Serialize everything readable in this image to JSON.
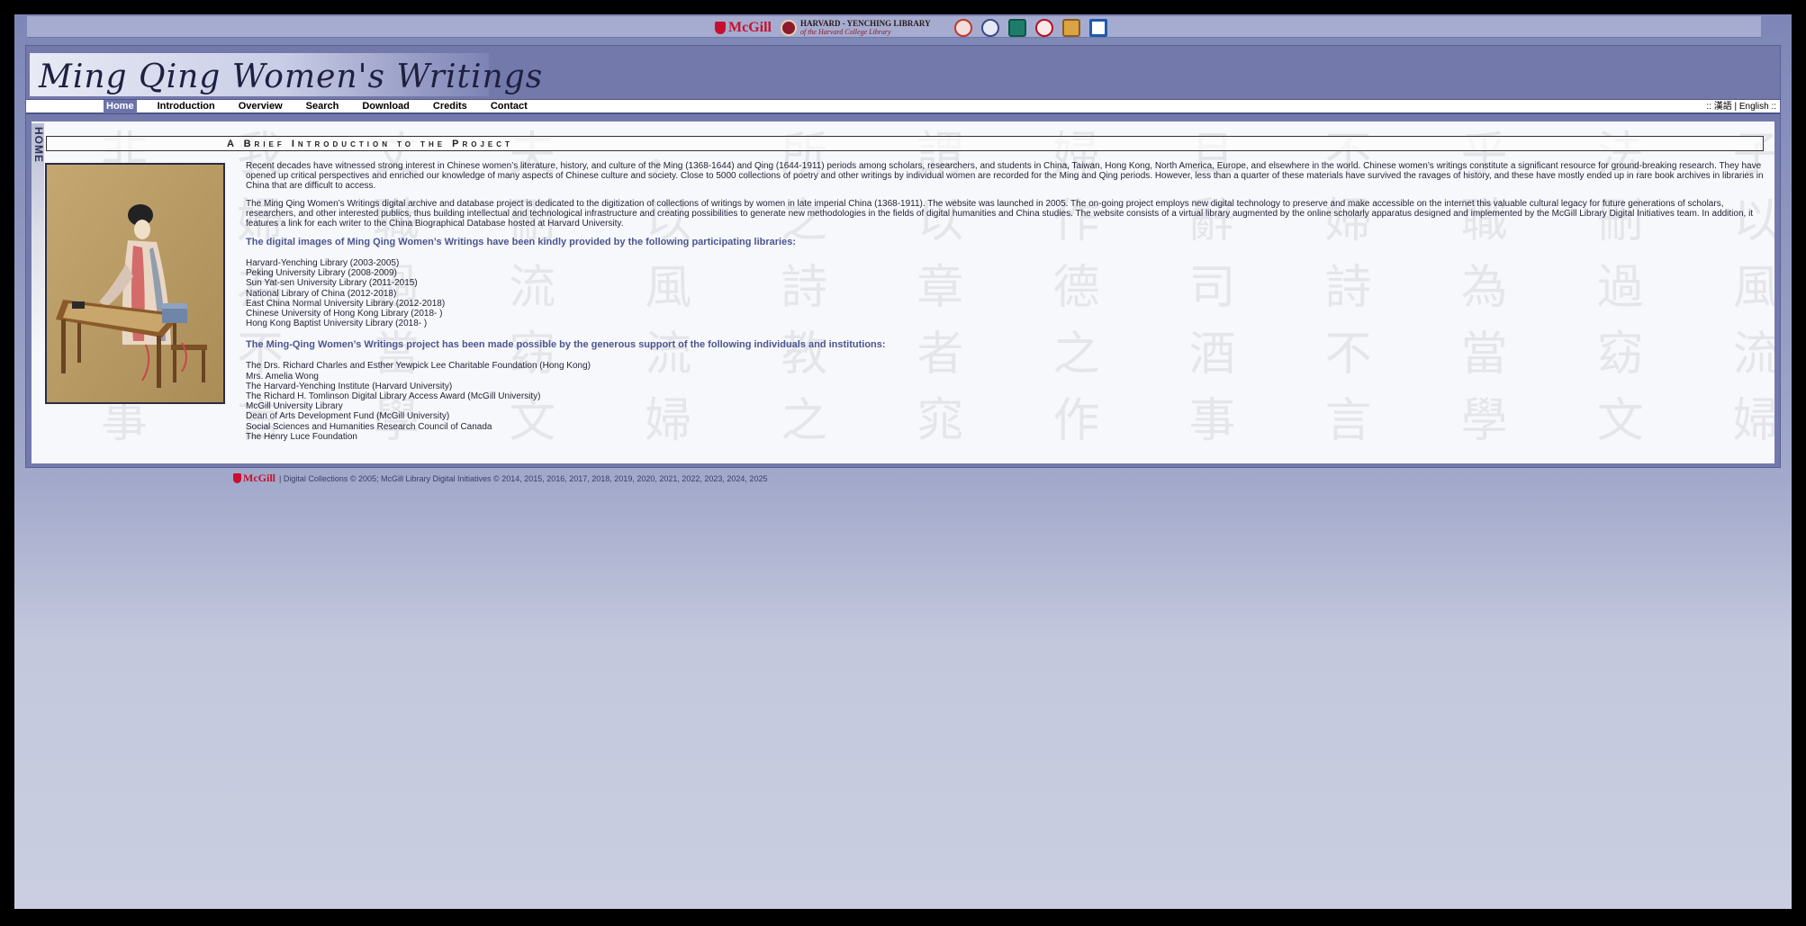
{
  "partners": {
    "mcgill": "McGill",
    "harvard_line1": "HARVARD - YENCHING LIBRARY",
    "harvard_line2": "of the Harvard College Library"
  },
  "site": {
    "title": "Ming Qing Women's Writings"
  },
  "nav": {
    "items": [
      "Home",
      "Introduction",
      "Overview",
      "Search",
      "Download",
      "Credits",
      "Contact"
    ],
    "active": "Home",
    "language": ":: 漢語 | English ::"
  },
  "content": {
    "side_tab": "HOME",
    "section_title": "A Brief Introduction to the Project",
    "paragraph1": "Recent decades have witnessed strong interest in Chinese women’s literature, history, and culture of the Ming (1368-1644) and Qing (1644-1911) periods among scholars, researchers, and students in China, Taiwan, Hong Kong, North America, Europe, and elsewhere in the world. Chinese women’s writings constitute a significant resource for ground-breaking research. They have opened up critical perspectives and enriched our knowledge of many aspects of Chinese culture and society. Close to 5000 collections of poetry and other writings by individual women are recorded for the Ming and Qing periods. However, less than a quarter of these materials have survived the ravages of history, and these have mostly ended up in rare book archives in libraries in China that are difficult to access.",
    "paragraph2": "The Ming Qing Women’s Writings digital archive and database project is dedicated to the digitization of collections of writings by women in late imperial China (1368-1911). The website was launched in 2005. The on-going project employs new digital technology to preserve and make accessible on the internet this valuable cultural legacy for future generations of scholars, researchers, and other interested publics, thus building intellectual and technological infrastructure and creating possibilities to generate new methodologies in the fields of digital humanities and China studies. The website consists of a virtual library augmented by the online scholarly apparatus designed and implemented by the McGill Library Digital Initiatives team. In addition, it features a link for each writer to the China Biographical Database hosted at Harvard University.",
    "libraries_heading": "The digital images of Ming Qing Women’s Writings have been kindly provided by the following participating libraries:",
    "libraries": [
      "Harvard-Yenching Library (2003-2005)",
      "Peking University Library (2008-2009)",
      "Sun Yat-sen University Library (2011-2015)",
      "National Library of China (2012-2018)",
      "East China Normal University Library (2012-2018)",
      "Chinese University of Hong Kong Library (2018- )",
      "Hong Kong Baptist University Library (2018- )"
    ],
    "supporters_heading": "The Ming-Qing Women’s Writings project has been made possible by the generous support of the following individuals and institutions:",
    "supporters": [
      "The Drs. Richard Charles and Esther Yewpick Lee Charitable Foundation (Hong Kong)",
      "Mrs. Amelia Wong",
      "The Harvard-Yenching Institute (Harvard University)",
      "The Richard H. Tomlinson Digital Library Access Award (McGill University)",
      "McGill University Library",
      "Dean of Arts Development Fund (McGill University)",
      "Social Sciences and Humanities Research Council of Canada",
      "The Henry Luce Foundation"
    ]
  },
  "footer": {
    "logo": "McGill",
    "text": "| Digital Collections © 2005; McGill Library Digital Initiatives © 2014, 2015, 2016, 2017, 2018, 2019, 2020, 2021, 2022, 2023, 2024, 2025"
  },
  "colors": {
    "frame": "#7479ab",
    "nav_active": "#6b73a8",
    "heading": "#4b5590",
    "mcgill_red": "#c8102e"
  },
  "icons": [
    "mcgill-shield-icon",
    "harvard-seal-icon",
    "partner-logo-icon",
    "painting-image"
  ]
}
